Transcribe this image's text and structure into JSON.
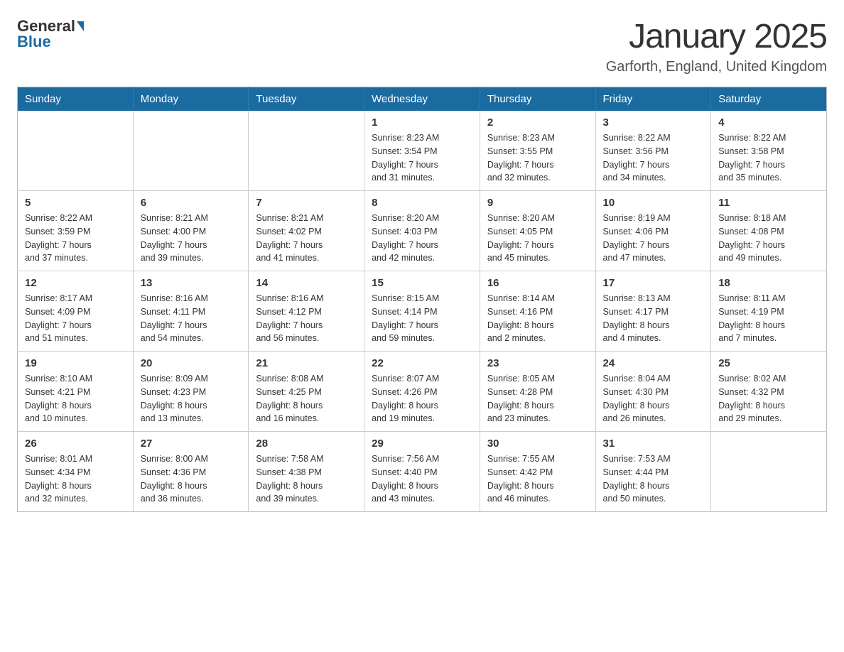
{
  "logo": {
    "general": "General",
    "blue": "Blue"
  },
  "header": {
    "title": "January 2025",
    "subtitle": "Garforth, England, United Kingdom"
  },
  "weekdays": [
    "Sunday",
    "Monday",
    "Tuesday",
    "Wednesday",
    "Thursday",
    "Friday",
    "Saturday"
  ],
  "weeks": [
    [
      {
        "day": "",
        "info": ""
      },
      {
        "day": "",
        "info": ""
      },
      {
        "day": "",
        "info": ""
      },
      {
        "day": "1",
        "info": "Sunrise: 8:23 AM\nSunset: 3:54 PM\nDaylight: 7 hours\nand 31 minutes."
      },
      {
        "day": "2",
        "info": "Sunrise: 8:23 AM\nSunset: 3:55 PM\nDaylight: 7 hours\nand 32 minutes."
      },
      {
        "day": "3",
        "info": "Sunrise: 8:22 AM\nSunset: 3:56 PM\nDaylight: 7 hours\nand 34 minutes."
      },
      {
        "day": "4",
        "info": "Sunrise: 8:22 AM\nSunset: 3:58 PM\nDaylight: 7 hours\nand 35 minutes."
      }
    ],
    [
      {
        "day": "5",
        "info": "Sunrise: 8:22 AM\nSunset: 3:59 PM\nDaylight: 7 hours\nand 37 minutes."
      },
      {
        "day": "6",
        "info": "Sunrise: 8:21 AM\nSunset: 4:00 PM\nDaylight: 7 hours\nand 39 minutes."
      },
      {
        "day": "7",
        "info": "Sunrise: 8:21 AM\nSunset: 4:02 PM\nDaylight: 7 hours\nand 41 minutes."
      },
      {
        "day": "8",
        "info": "Sunrise: 8:20 AM\nSunset: 4:03 PM\nDaylight: 7 hours\nand 42 minutes."
      },
      {
        "day": "9",
        "info": "Sunrise: 8:20 AM\nSunset: 4:05 PM\nDaylight: 7 hours\nand 45 minutes."
      },
      {
        "day": "10",
        "info": "Sunrise: 8:19 AM\nSunset: 4:06 PM\nDaylight: 7 hours\nand 47 minutes."
      },
      {
        "day": "11",
        "info": "Sunrise: 8:18 AM\nSunset: 4:08 PM\nDaylight: 7 hours\nand 49 minutes."
      }
    ],
    [
      {
        "day": "12",
        "info": "Sunrise: 8:17 AM\nSunset: 4:09 PM\nDaylight: 7 hours\nand 51 minutes."
      },
      {
        "day": "13",
        "info": "Sunrise: 8:16 AM\nSunset: 4:11 PM\nDaylight: 7 hours\nand 54 minutes."
      },
      {
        "day": "14",
        "info": "Sunrise: 8:16 AM\nSunset: 4:12 PM\nDaylight: 7 hours\nand 56 minutes."
      },
      {
        "day": "15",
        "info": "Sunrise: 8:15 AM\nSunset: 4:14 PM\nDaylight: 7 hours\nand 59 minutes."
      },
      {
        "day": "16",
        "info": "Sunrise: 8:14 AM\nSunset: 4:16 PM\nDaylight: 8 hours\nand 2 minutes."
      },
      {
        "day": "17",
        "info": "Sunrise: 8:13 AM\nSunset: 4:17 PM\nDaylight: 8 hours\nand 4 minutes."
      },
      {
        "day": "18",
        "info": "Sunrise: 8:11 AM\nSunset: 4:19 PM\nDaylight: 8 hours\nand 7 minutes."
      }
    ],
    [
      {
        "day": "19",
        "info": "Sunrise: 8:10 AM\nSunset: 4:21 PM\nDaylight: 8 hours\nand 10 minutes."
      },
      {
        "day": "20",
        "info": "Sunrise: 8:09 AM\nSunset: 4:23 PM\nDaylight: 8 hours\nand 13 minutes."
      },
      {
        "day": "21",
        "info": "Sunrise: 8:08 AM\nSunset: 4:25 PM\nDaylight: 8 hours\nand 16 minutes."
      },
      {
        "day": "22",
        "info": "Sunrise: 8:07 AM\nSunset: 4:26 PM\nDaylight: 8 hours\nand 19 minutes."
      },
      {
        "day": "23",
        "info": "Sunrise: 8:05 AM\nSunset: 4:28 PM\nDaylight: 8 hours\nand 23 minutes."
      },
      {
        "day": "24",
        "info": "Sunrise: 8:04 AM\nSunset: 4:30 PM\nDaylight: 8 hours\nand 26 minutes."
      },
      {
        "day": "25",
        "info": "Sunrise: 8:02 AM\nSunset: 4:32 PM\nDaylight: 8 hours\nand 29 minutes."
      }
    ],
    [
      {
        "day": "26",
        "info": "Sunrise: 8:01 AM\nSunset: 4:34 PM\nDaylight: 8 hours\nand 32 minutes."
      },
      {
        "day": "27",
        "info": "Sunrise: 8:00 AM\nSunset: 4:36 PM\nDaylight: 8 hours\nand 36 minutes."
      },
      {
        "day": "28",
        "info": "Sunrise: 7:58 AM\nSunset: 4:38 PM\nDaylight: 8 hours\nand 39 minutes."
      },
      {
        "day": "29",
        "info": "Sunrise: 7:56 AM\nSunset: 4:40 PM\nDaylight: 8 hours\nand 43 minutes."
      },
      {
        "day": "30",
        "info": "Sunrise: 7:55 AM\nSunset: 4:42 PM\nDaylight: 8 hours\nand 46 minutes."
      },
      {
        "day": "31",
        "info": "Sunrise: 7:53 AM\nSunset: 4:44 PM\nDaylight: 8 hours\nand 50 minutes."
      },
      {
        "day": "",
        "info": ""
      }
    ]
  ]
}
